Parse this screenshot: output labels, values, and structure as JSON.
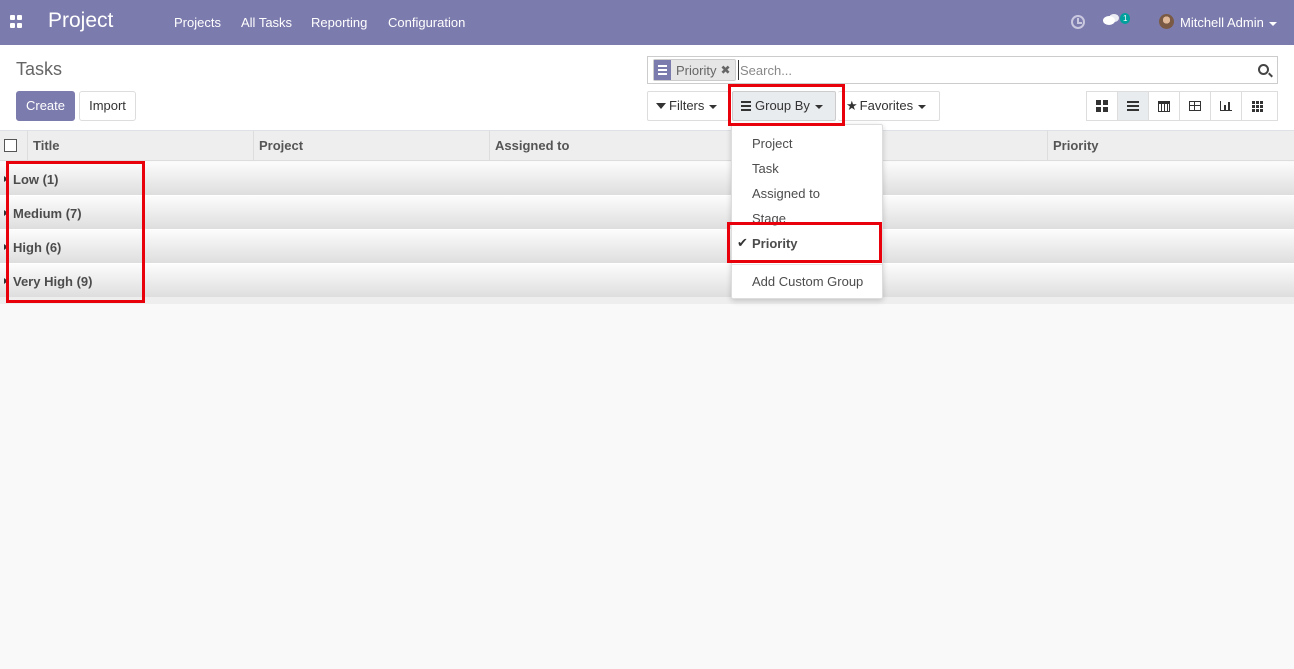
{
  "navbar": {
    "brand": "Project",
    "menus": [
      "Projects",
      "All Tasks",
      "Reporting",
      "Configuration"
    ],
    "chat_count": "1",
    "user_name": "Mitchell Admin"
  },
  "control_panel": {
    "title": "Tasks",
    "create_label": "Create",
    "import_label": "Import",
    "search": {
      "facet_label": "Priority",
      "facet_remove": "✖",
      "placeholder": "Search..."
    },
    "filters_label": "Filters",
    "group_by_label": "Group By",
    "favorites_label": "Favorites"
  },
  "group_by_menu": {
    "items": [
      "Project",
      "Task",
      "Assigned to",
      "Stage",
      "Priority"
    ],
    "selected": "Priority",
    "custom": "Add Custom Group"
  },
  "table": {
    "columns": [
      "Title",
      "Project",
      "Assigned to",
      "Priority"
    ],
    "groups": [
      "Low (1)",
      "Medium (7)",
      "High (6)",
      "Very High (9)"
    ]
  },
  "colors": {
    "brand": "#7c7bad",
    "highlight": "#e8000b",
    "chat_badge": "#00a09d"
  }
}
